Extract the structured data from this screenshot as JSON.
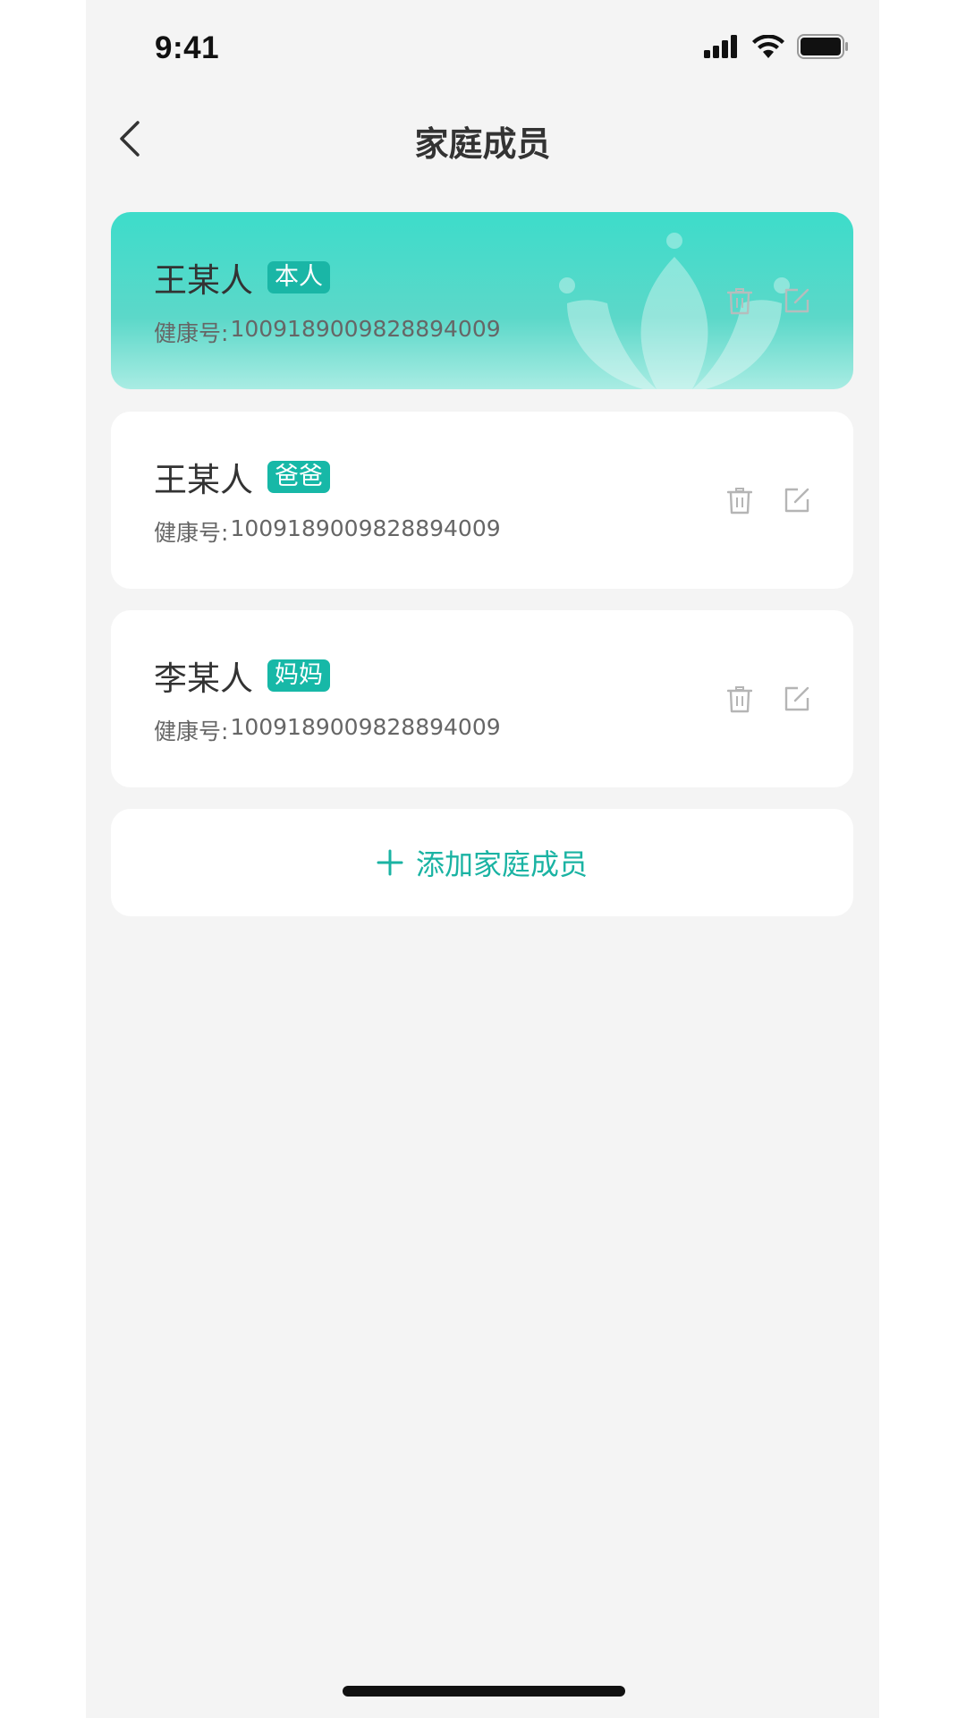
{
  "status_bar": {
    "time": "9:41"
  },
  "nav": {
    "title": "家庭成员"
  },
  "members": [
    {
      "name": "王某人",
      "tag": "本人",
      "health_label": "健康号:",
      "health_no": "1009189009828894009"
    },
    {
      "name": "王某人",
      "tag": "爸爸",
      "health_label": "健康号:",
      "health_no": "1009189009828894009"
    },
    {
      "name": "李某人",
      "tag": "妈妈",
      "health_label": "健康号:",
      "health_no": "1009189009828894009"
    }
  ],
  "add_button": {
    "label": "添加家庭成员"
  },
  "colors": {
    "accent": "#1ab3a3",
    "primary_card": "#3ddcca",
    "background": "#f4f4f4"
  }
}
